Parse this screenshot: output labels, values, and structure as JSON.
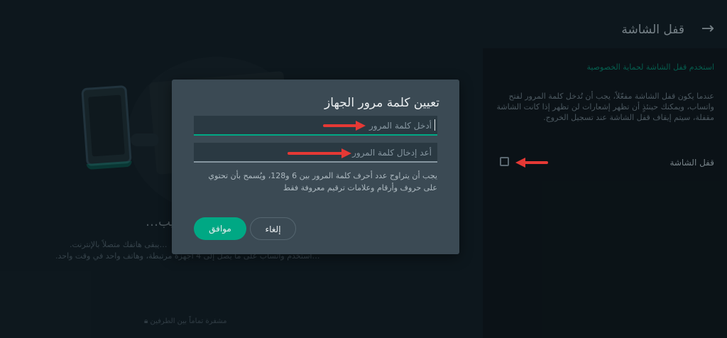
{
  "header": {
    "title": "قفل الشاشة",
    "back_icon": "arrow-right-icon"
  },
  "settings": {
    "link_text": "استخدم قفل الشاشة لحماية الخصوصية",
    "description": "عندما يكون قفل الشاشة مفعّلاً، يجب أن تُدخل كلمة المرور لفتح واتساب، ويمكنك حينئذٍ أن تظهر إشعارات لن تظهر إذا كانت الشاشة مقفلة، سيتم إيقاف قفل الشاشة عند تسجيل الخروج.",
    "toggle_label": "قفل الشاشة",
    "toggle_checked": false
  },
  "background": {
    "heading": "…ويب",
    "text1": "…يبقى هاتفك متصلاً بالإنترنت.",
    "text2": "…استخدم واتساب على ما يصل إلى 4 أجهزة مرتبطة، وهاتف واحد في وقت واحد.",
    "footer": "مشفرة تماماً بين الطرفين"
  },
  "dialog": {
    "title": "تعيين كلمة مرور الجهاز",
    "password_placeholder": "أدخل كلمة المرور",
    "confirm_placeholder": "أعد إدخال كلمة المرور",
    "hint": "يجب أن يتراوح عدد أحرف كلمة المرور بين 6 و128، ويُسمح بأن تحتوي على حروف وأرقام وعلامات ترقيم معروفة فقط",
    "ok_label": "موافق",
    "cancel_label": "إلغاء"
  },
  "colors": {
    "accent": "#00a884",
    "annotation": "#e53935",
    "dialog_bg": "#3b4a54"
  }
}
